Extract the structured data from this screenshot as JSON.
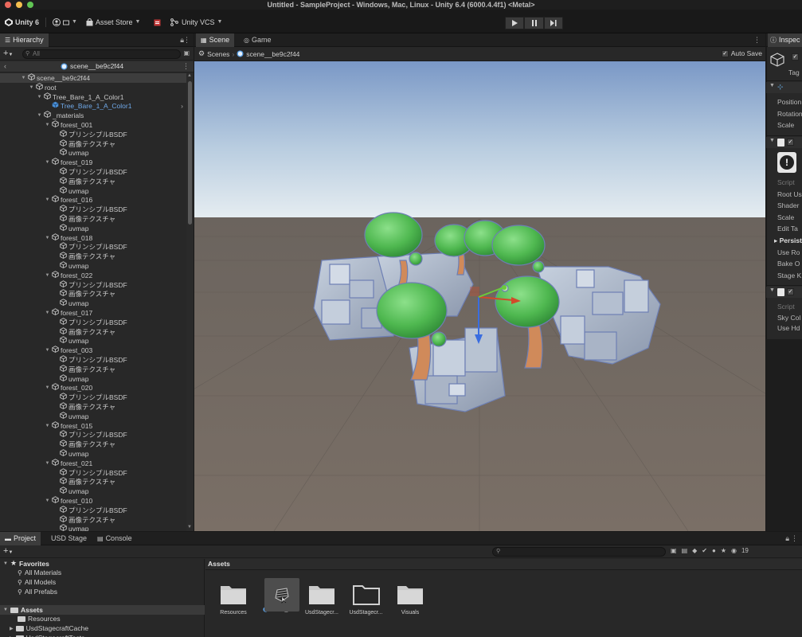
{
  "window": {
    "title": "Untitled - SampleProject - Windows, Mac, Linux - Unity 6.4 (6000.4.4f1) <Metal>"
  },
  "toolbar": {
    "unity_label": "Unity 6",
    "asset_store": "Asset Store",
    "vcs": "Unity VCS"
  },
  "hierarchy": {
    "tab": "Hierarchy",
    "search_placeholder": "All",
    "scene_header": "scene__be9c2f44",
    "rows": [
      {
        "label": "scene__be9c2f44",
        "depth": 0
      },
      {
        "label": "root",
        "depth": 1
      },
      {
        "label": "Tree_Bare_1_A_Color1",
        "depth": 2
      },
      {
        "label": "Tree_Bare_1_A_Color1",
        "depth": 3
      },
      {
        "label": "_materials",
        "depth": 2
      },
      {
        "label": "forest_001",
        "depth": 3
      },
      {
        "label": "プリンシプルBSDF",
        "depth": 4
      },
      {
        "label": "画像テクスチャ",
        "depth": 4
      },
      {
        "label": "uvmap",
        "depth": 4
      },
      {
        "label": "forest_019",
        "depth": 3
      },
      {
        "label": "プリンシプルBSDF",
        "depth": 4
      },
      {
        "label": "画像テクスチャ",
        "depth": 4
      },
      {
        "label": "uvmap",
        "depth": 4
      },
      {
        "label": "forest_016",
        "depth": 3
      },
      {
        "label": "プリンシプルBSDF",
        "depth": 4
      },
      {
        "label": "画像テクスチャ",
        "depth": 4
      },
      {
        "label": "uvmap",
        "depth": 4
      },
      {
        "label": "forest_018",
        "depth": 3
      },
      {
        "label": "プリンシプルBSDF",
        "depth": 4
      },
      {
        "label": "画像テクスチャ",
        "depth": 4
      },
      {
        "label": "uvmap",
        "depth": 4
      },
      {
        "label": "forest_022",
        "depth": 3
      },
      {
        "label": "プリンシプルBSDF",
        "depth": 4
      },
      {
        "label": "画像テクスチャ",
        "depth": 4
      },
      {
        "label": "uvmap",
        "depth": 4
      },
      {
        "label": "forest_017",
        "depth": 3
      },
      {
        "label": "プリンシプルBSDF",
        "depth": 4
      },
      {
        "label": "画像テクスチャ",
        "depth": 4
      },
      {
        "label": "uvmap",
        "depth": 4
      },
      {
        "label": "forest_003",
        "depth": 3
      },
      {
        "label": "プリンシプルBSDF",
        "depth": 4
      },
      {
        "label": "画像テクスチャ",
        "depth": 4
      },
      {
        "label": "uvmap",
        "depth": 4
      },
      {
        "label": "forest_020",
        "depth": 3
      },
      {
        "label": "プリンシプルBSDF",
        "depth": 4
      },
      {
        "label": "画像テクスチャ",
        "depth": 4
      },
      {
        "label": "uvmap",
        "depth": 4
      },
      {
        "label": "forest_015",
        "depth": 3
      },
      {
        "label": "プリンシプルBSDF",
        "depth": 4
      },
      {
        "label": "画像テクスチャ",
        "depth": 4
      },
      {
        "label": "uvmap",
        "depth": 4
      },
      {
        "label": "forest_021",
        "depth": 3
      },
      {
        "label": "プリンシプルBSDF",
        "depth": 4
      },
      {
        "label": "画像テクスチャ",
        "depth": 4
      },
      {
        "label": "uvmap",
        "depth": 4
      },
      {
        "label": "forest_010",
        "depth": 3
      },
      {
        "label": "プリンシプルBSDF",
        "depth": 4
      },
      {
        "label": "画像テクスチャ",
        "depth": 4
      },
      {
        "label": "uvmap",
        "depth": 4
      }
    ]
  },
  "scene": {
    "tabs": [
      "Scene",
      "Game"
    ],
    "breadcrumb_root": "Scenes",
    "breadcrumb_scene": "scene__be9c2f44",
    "auto_save": "Auto Save"
  },
  "inspector": {
    "tab": "Inspec",
    "tag_label": "Tag",
    "transform_fields": [
      "Position",
      "Rotation",
      "Scale"
    ],
    "component1_fields": [
      "Script",
      "Root Us",
      "Shader",
      "Scale",
      "Edit Ta",
      "Persist",
      "Use Ro",
      "Bake O",
      "Stage K"
    ],
    "component2_fields": [
      "Script",
      "Sky Col",
      "Use Hd"
    ]
  },
  "bottom": {
    "tabs": [
      "Project",
      "USD Stage",
      "Console"
    ],
    "favorites": {
      "label": "Favorites",
      "items": [
        "All Materials",
        "All Models",
        "All Prefabs"
      ]
    },
    "assets_tree": {
      "label": "Assets",
      "items": [
        "Resources",
        "UsdStagecraftCache",
        "UsdStagecraftTests"
      ]
    },
    "assets_header": "Assets",
    "hidden_count": "19",
    "assets": [
      {
        "label": "Resources",
        "kind": "folder"
      },
      {
        "label": "scene_...",
        "kind": "scene"
      },
      {
        "label": "UsdStagecr...",
        "kind": "folder"
      },
      {
        "label": "UsdStagecr...",
        "kind": "folder-open"
      },
      {
        "label": "Visuals",
        "kind": "folder"
      }
    ]
  },
  "colors": {
    "accent_blue": "#4a8fd6",
    "sky_top": "#7c9cc9",
    "ground": "#6f655c",
    "tree_canopy": "#5cc05c",
    "tree_trunk": "#d08a5a",
    "rock": "#aab6c8"
  }
}
